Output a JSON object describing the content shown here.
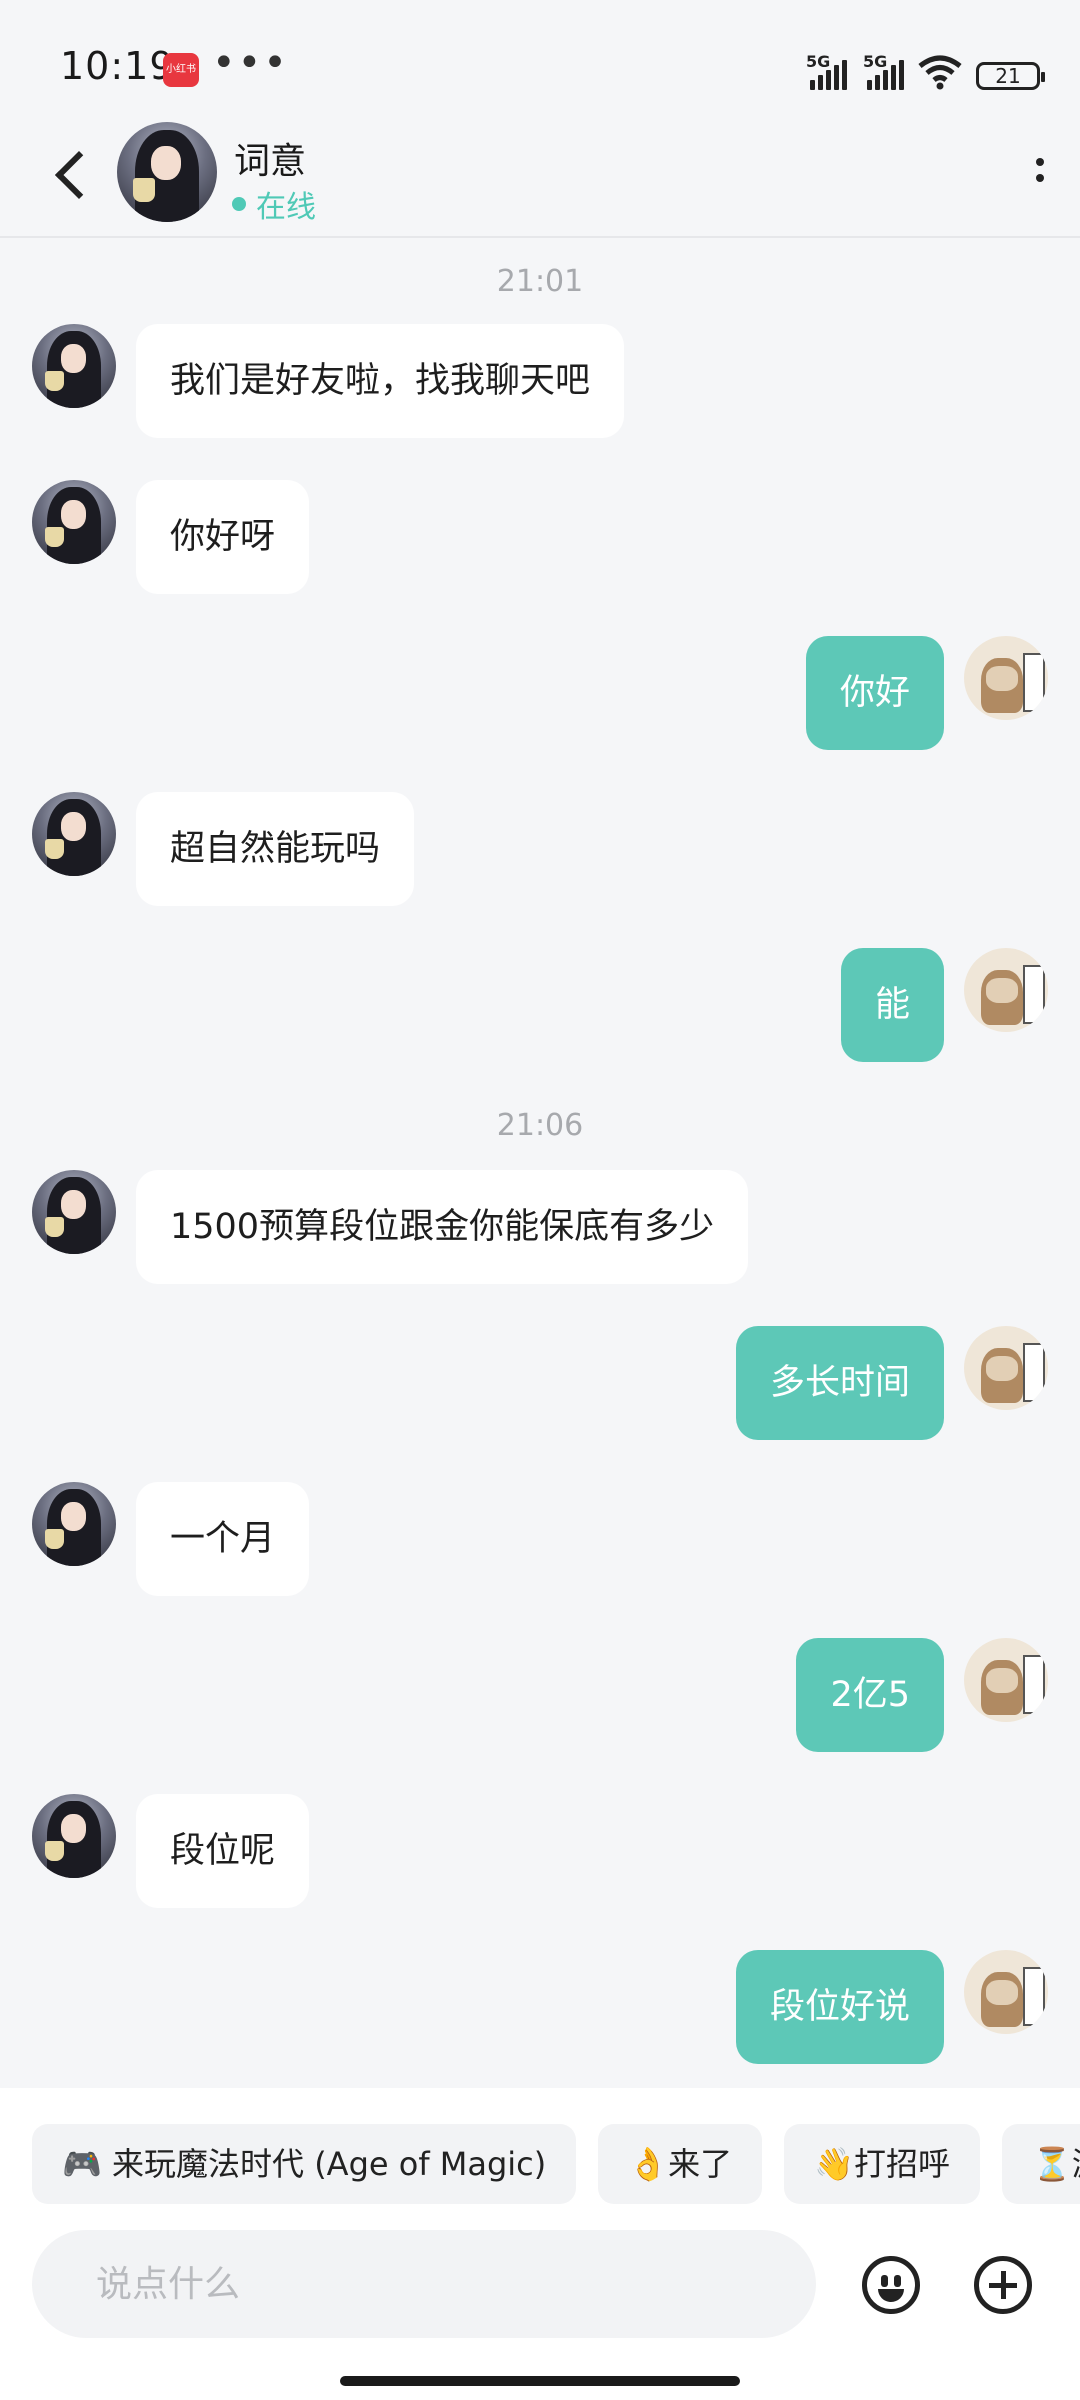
{
  "status_bar": {
    "time": "10:19",
    "app_badge": "小红书",
    "overflow_dots": "•••",
    "network_1": "5G",
    "network_2": "5G",
    "battery": "21"
  },
  "header": {
    "contact_name": "词意",
    "status": "在线"
  },
  "messages": [
    {
      "type": "time",
      "text": "21:01"
    },
    {
      "type": "msg",
      "side": "left",
      "text": "我们是好友啦，找我聊天吧"
    },
    {
      "type": "msg",
      "side": "left",
      "text": "你好呀"
    },
    {
      "type": "msg",
      "side": "right",
      "text": "你好"
    },
    {
      "type": "msg",
      "side": "left",
      "text": "超自然能玩吗"
    },
    {
      "type": "msg",
      "side": "right",
      "text": "能"
    },
    {
      "type": "time",
      "text": "21:06"
    },
    {
      "type": "msg",
      "side": "left",
      "text": "1500预算段位跟金你能保底有多少"
    },
    {
      "type": "msg",
      "side": "right",
      "text": "多长时间"
    },
    {
      "type": "msg",
      "side": "left",
      "text": "一个月"
    },
    {
      "type": "msg",
      "side": "right",
      "text": "2亿5"
    },
    {
      "type": "msg",
      "side": "left",
      "text": "段位呢"
    },
    {
      "type": "msg",
      "side": "right",
      "text": "段位好说"
    }
  ],
  "quick_replies": [
    "🎮 来玩魔法时代 (Age of Magic)",
    "👌来了",
    "👋打招呼",
    "⏳游"
  ],
  "input": {
    "placeholder": "说点什么"
  },
  "colors": {
    "accent": "#5dc8b7",
    "online": "#4fc9b6",
    "background": "#f5f6f8"
  }
}
